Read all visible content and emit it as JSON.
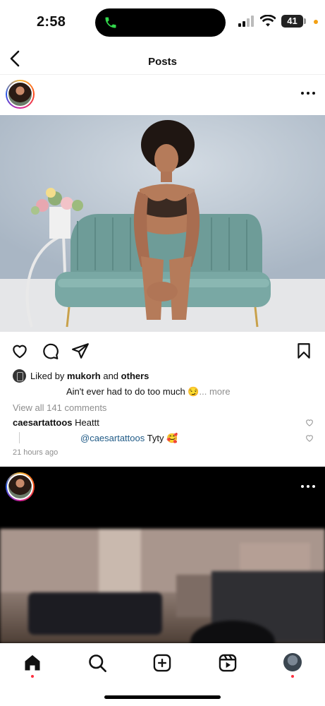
{
  "status_bar": {
    "time": "2:58",
    "battery": "41",
    "icons": [
      "phone-call-icon",
      "cellular-signal-icon",
      "wifi-icon",
      "battery-icon"
    ]
  },
  "header": {
    "title": "Posts",
    "back_icon": "chevron-left-icon"
  },
  "post1": {
    "more_icon": "ellipsis-icon",
    "actions": [
      "heart-icon",
      "comment-icon",
      "share-icon",
      "bookmark-icon"
    ],
    "likes": {
      "prefix": "Liked by",
      "user": "mukorh",
      "joiner": "and",
      "rest": "others"
    },
    "caption": {
      "text": "Ain't ever had to do too much 😏",
      "more": "... more"
    },
    "view_comments": "View all 141 comments",
    "comments": [
      {
        "user": "caesartattoos",
        "text": "Heattt"
      },
      {
        "mention": "@caesartattoos",
        "text": "Tyty 🥰"
      }
    ],
    "time": "21 hours ago"
  },
  "post2": {
    "more_icon": "ellipsis-icon"
  },
  "bottom_nav": {
    "items": [
      "home-icon",
      "search-icon",
      "create-icon",
      "reels-icon",
      "profile-avatar"
    ]
  },
  "colors": {
    "accent_notification": "#ff3040",
    "mention": "#1f5a86",
    "muted": "#8e8e8e"
  }
}
